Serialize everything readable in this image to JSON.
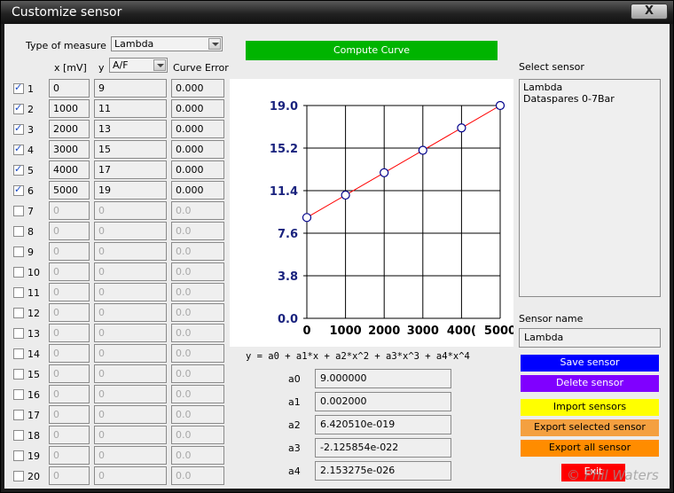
{
  "window": {
    "title": "Customize sensor",
    "close_label": "X"
  },
  "type_of_measure": {
    "label": "Type of measure",
    "value": "Lambda"
  },
  "columns": {
    "x": "x [mV]",
    "y_label": "y",
    "y_select": "A/F",
    "err": "Curve Error"
  },
  "rows": [
    {
      "n": "1",
      "checked": true,
      "x": "0",
      "y": "9",
      "err": "0.000"
    },
    {
      "n": "2",
      "checked": true,
      "x": "1000",
      "y": "11",
      "err": "0.000"
    },
    {
      "n": "3",
      "checked": true,
      "x": "2000",
      "y": "13",
      "err": "0.000"
    },
    {
      "n": "4",
      "checked": true,
      "x": "3000",
      "y": "15",
      "err": "0.000"
    },
    {
      "n": "5",
      "checked": true,
      "x": "4000",
      "y": "17",
      "err": "0.000"
    },
    {
      "n": "6",
      "checked": true,
      "x": "5000",
      "y": "19",
      "err": "0.000"
    },
    {
      "n": "7",
      "checked": false,
      "x": "0",
      "y": "0",
      "err": "0.0"
    },
    {
      "n": "8",
      "checked": false,
      "x": "0",
      "y": "0",
      "err": "0.0"
    },
    {
      "n": "9",
      "checked": false,
      "x": "0",
      "y": "0",
      "err": "0.0"
    },
    {
      "n": "10",
      "checked": false,
      "x": "0",
      "y": "0",
      "err": "0.0"
    },
    {
      "n": "11",
      "checked": false,
      "x": "0",
      "y": "0",
      "err": "0.0"
    },
    {
      "n": "12",
      "checked": false,
      "x": "0",
      "y": "0",
      "err": "0.0"
    },
    {
      "n": "13",
      "checked": false,
      "x": "0",
      "y": "0",
      "err": "0.0"
    },
    {
      "n": "14",
      "checked": false,
      "x": "0",
      "y": "0",
      "err": "0.0"
    },
    {
      "n": "15",
      "checked": false,
      "x": "0",
      "y": "0",
      "err": "0.0"
    },
    {
      "n": "16",
      "checked": false,
      "x": "0",
      "y": "0",
      "err": "0.0"
    },
    {
      "n": "17",
      "checked": false,
      "x": "0",
      "y": "0",
      "err": "0.0"
    },
    {
      "n": "18",
      "checked": false,
      "x": "0",
      "y": "0",
      "err": "0.0"
    },
    {
      "n": "19",
      "checked": false,
      "x": "0",
      "y": "0",
      "err": "0.0"
    },
    {
      "n": "20",
      "checked": false,
      "x": "0",
      "y": "0",
      "err": "0.0"
    }
  ],
  "compute_button": {
    "label": "Compute Curve",
    "color": "#00b400"
  },
  "chart_data": {
    "type": "line",
    "x": [
      0,
      1000,
      2000,
      3000,
      4000,
      5000
    ],
    "series": [
      {
        "values": [
          9,
          11,
          13,
          15,
          17,
          19
        ]
      }
    ],
    "xticks": [
      "0",
      "1000",
      "2000",
      "3000",
      "400(",
      "5000"
    ],
    "yticks": [
      "0.0",
      "3.8",
      "7.6",
      "11.4",
      "15.2",
      "19.0"
    ],
    "xlim": [
      0,
      5000
    ],
    "ylim": [
      0,
      19
    ],
    "grid": true,
    "line_color": "#ff0000",
    "marker_color": "#00008b"
  },
  "formula": "y = a0 + a1*x + a2*x^2 + a3*x^3 + a4*x^4",
  "coefficients": [
    {
      "name": "a0",
      "value": "9.000000"
    },
    {
      "name": "a1",
      "value": "0.002000"
    },
    {
      "name": "a2",
      "value": "6.420510e-019"
    },
    {
      "name": "a3",
      "value": "-2.125854e-022"
    },
    {
      "name": "a4",
      "value": "2.153275e-026"
    }
  ],
  "select_sensor": {
    "label": "Select sensor",
    "items": [
      "Lambda",
      "Dataspares 0-7Bar"
    ]
  },
  "sensor_name": {
    "label": "Sensor name",
    "value": "Lambda"
  },
  "buttons": {
    "save": {
      "label": "Save sensor",
      "bg": "#0000ff",
      "fg": "#ffffff"
    },
    "delete": {
      "label": "Delete sensor",
      "bg": "#8000ff",
      "fg": "#ffffff"
    },
    "import": {
      "label": "Import sensors",
      "bg": "#ffff00",
      "fg": "#000000"
    },
    "export_selected": {
      "label": "Export selected sensor",
      "bg": "#f4a040",
      "fg": "#000000"
    },
    "export_all": {
      "label": "Export all sensor",
      "bg": "#ff8c00",
      "fg": "#000000"
    },
    "exit": {
      "label": "Exit",
      "bg": "#ff0000",
      "fg": "#ffffff"
    }
  },
  "watermark": "© Phil Waters"
}
